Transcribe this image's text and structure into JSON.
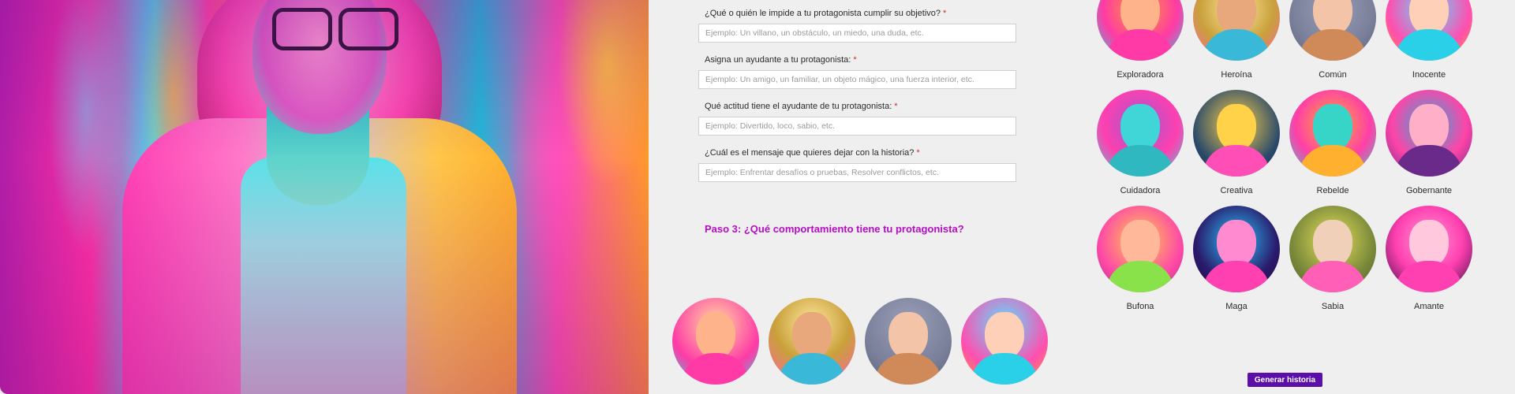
{
  "hero": {
    "icon": "hero-portrait-image"
  },
  "form": {
    "questions": [
      {
        "label": "¿Qué o quién le impide a tu protagonista cumplir su objetivo?",
        "required": "*",
        "placeholder": "Ejemplo: Un villano, un obstáculo, un miedo, una duda, etc."
      },
      {
        "label": "Asigna un ayudante a tu protagonista:",
        "required": "*",
        "placeholder": "Ejemplo: Un amigo, un familiar, un objeto mágico, una fuerza interior, etc."
      },
      {
        "label": "Qué actitud tiene el ayudante de tu protagonista:",
        "required": "*",
        "placeholder": "Ejemplo: Divertido, loco, sabio, etc."
      },
      {
        "label": "¿Cuál es el mensaje que quieres dejar con la historia?",
        "required": "*",
        "placeholder": "Ejemplo: Enfrentar desafíos o pruebas, Resolver conflictos, etc."
      }
    ],
    "step3_title": "Paso 3: ¿Qué comportamiento tiene tu protagonista?"
  },
  "archetypes": [
    {
      "name": "Exploradora",
      "colors": [
        "#ff3aa6",
        "#2bd3e0",
        "#ff9d2e"
      ]
    },
    {
      "name": "Heroína",
      "colors": [
        "#c9a03a",
        "#ff5fb2",
        "#3ab8d8"
      ]
    },
    {
      "name": "Común",
      "colors": [
        "#7a7f9a",
        "#d08a5a",
        "#f3c4a8"
      ]
    },
    {
      "name": "Inocente",
      "colors": [
        "#ff9a2a",
        "#ff4fb0",
        "#2ad0e8"
      ]
    },
    {
      "name": "Cuidadora",
      "colors": [
        "#ff3fb0",
        "#40d6d8",
        "#9a5ad0"
      ]
    },
    {
      "name": "Creativa",
      "colors": [
        "#2a4a6a",
        "#ffd24a",
        "#ff4fb6"
      ]
    },
    {
      "name": "Rebelde",
      "colors": [
        "#ff3fa8",
        "#37d5c8",
        "#ffb02e"
      ]
    },
    {
      "name": "Gobernante",
      "colors": [
        "#2ab0d8",
        "#ff44a8",
        "#6a2a8a"
      ]
    },
    {
      "name": "Bufona",
      "colors": [
        "#ff4aa6",
        "#8ae24a",
        "#ffd04a"
      ]
    },
    {
      "name": "Maga",
      "colors": [
        "#2a1a6a",
        "#ff40b0",
        "#28c8ff"
      ]
    },
    {
      "name": "Sabia",
      "colors": [
        "#7a8a3a",
        "#e8e05a",
        "#ff5fb6"
      ]
    },
    {
      "name": "Amante",
      "colors": [
        "#2a0a3a",
        "#ff40b0",
        "#ff9ad6"
      ]
    }
  ],
  "preview_avatars": [
    {
      "icon": "explorer-avatar-preview"
    },
    {
      "icon": "heroine-avatar-preview"
    },
    {
      "icon": "common-avatar-preview"
    },
    {
      "icon": "innocent-avatar-preview"
    }
  ],
  "generate_button": "Generar historia"
}
